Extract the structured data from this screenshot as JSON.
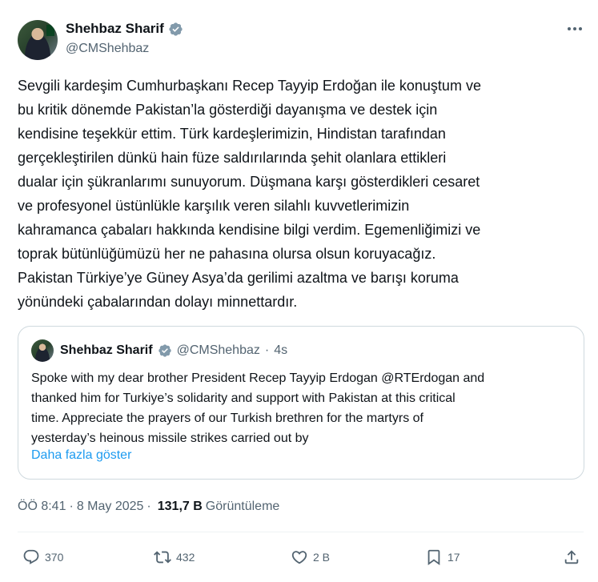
{
  "author": {
    "name": "Shehbaz Sharif",
    "handle": "@CMShehbaz"
  },
  "tweet": {
    "text": "Sevgili kardeşim Cumhurbaşkanı Recep Tayyip Erdoğan ile konuştum ve\nbu kritik dönemde Pakistan’la gösterdiği dayanışma ve destek için\nkendisine teşekkür ettim. Türk kardeşlerimizin, Hindistan tarafından\ngerçekleştirilen dünkü hain füze saldırılarında şehit olanlara ettikleri\ndualar için şükranlarımı sunuyorum. Düşmana karşı gösterdikleri cesaret\nve profesyonel üstünlükle karşılık veren silahlı kuvvetlerimizin\nkahramanca çabaları hakkında kendisine bilgi verdim. Egemenliğimizi ve\ntoprak bütünlüğümüzü her ne pahasına olursa olsun koruyacağız.\nPakistan Türkiye’ye Güney Asya’da gerilimi azaltma ve barışı koruma\nyönündeki çabalarından dolayı minnettardır."
  },
  "quote": {
    "name": "Shehbaz Sharif",
    "handle": "@CMShehbaz",
    "separator": "·",
    "time": "4s",
    "text": "Spoke with my dear brother President Recep Tayyip Erdogan @RTErdogan and\nthanked him for Turkiye’s solidarity and support with Pakistan at this critical\ntime. Appreciate the prayers of our Turkish brethren for the martyrs of\nyesterday’s heinous missile strikes carried out by",
    "show_more": "Daha fazla göster"
  },
  "meta": {
    "time": "ÖÖ 8:41",
    "separator": "·",
    "date": "8 May 2025",
    "separator2": "·",
    "views": "131,7 B",
    "views_label": "Görüntüleme"
  },
  "actions": {
    "replies": "370",
    "retweets": "432",
    "likes": "2 B",
    "bookmarks": "17"
  },
  "icons": {
    "verified": "verified-badge-icon",
    "more": "more-icon",
    "reply": "reply-icon",
    "retweet": "retweet-icon",
    "like": "heart-icon",
    "bookmark": "bookmark-icon",
    "share": "share-icon"
  },
  "colors": {
    "accent": "#1d9bf0",
    "text": "#0f1419",
    "secondary": "#536471",
    "border": "#cfd9de"
  }
}
